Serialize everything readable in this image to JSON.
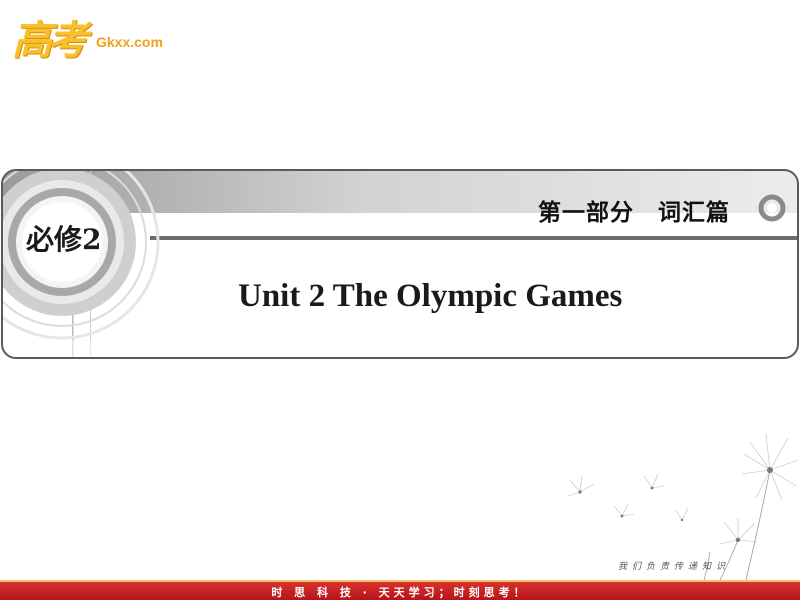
{
  "logo": {
    "chinese": "高考",
    "domain": "Gkxx.com"
  },
  "banner": {
    "book": "必修2",
    "part": "第一部分　词汇篇",
    "unit_title": "Unit 2  The Olympic Games"
  },
  "motto": "我们负责传递知识",
  "footer": {
    "text": "时 思 科 技 · 天天学习；时刻思考！"
  },
  "colors": {
    "logo_yellow": "#f7c12a",
    "footer_red": "#c8201f",
    "banner_grey": "#d6d6d6"
  }
}
